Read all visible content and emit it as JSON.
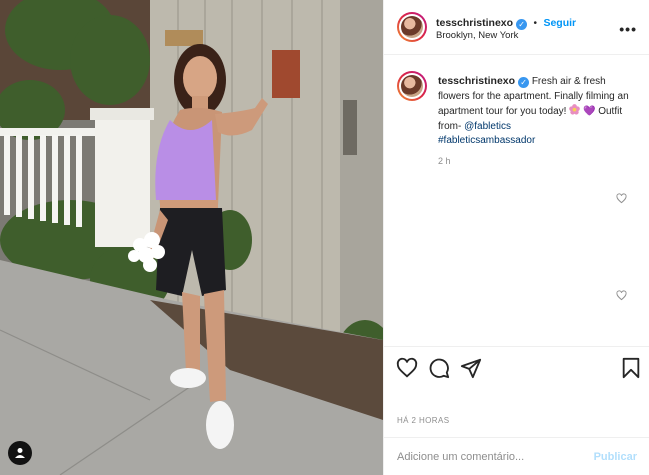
{
  "post": {
    "username": "tesschristinexo",
    "verified_mark": "✓",
    "follow_sep": "•",
    "follow_label": "Seguir",
    "location": "Brooklyn, New York",
    "more_label": "•••",
    "caption": {
      "username": "tesschristinexo",
      "text": "Fresh air & fresh flowers for the apartment. Finally filming an apartment tour for you today!",
      "emoji_heart": "💜",
      "outfit_text": "Outfit from-",
      "mention": "@fabletics",
      "hashtag": "#fableticsambassador"
    },
    "age": "2 h",
    "timestamp": "HÁ 2 HORAS",
    "comment_placeholder": "Adicione um comentário...",
    "publish_label": "Publicar"
  },
  "icons": {
    "tag": "user-tag-icon",
    "like": "heart-icon",
    "comment": "comment-icon",
    "share": "paper-plane-icon",
    "save": "bookmark-icon",
    "more": "more-options-icon"
  },
  "colors": {
    "link_blue": "#0095f6",
    "verified_blue": "#3897f0",
    "muted_text": "#8e8e8e",
    "publish_disabled": "#b2dffc"
  }
}
